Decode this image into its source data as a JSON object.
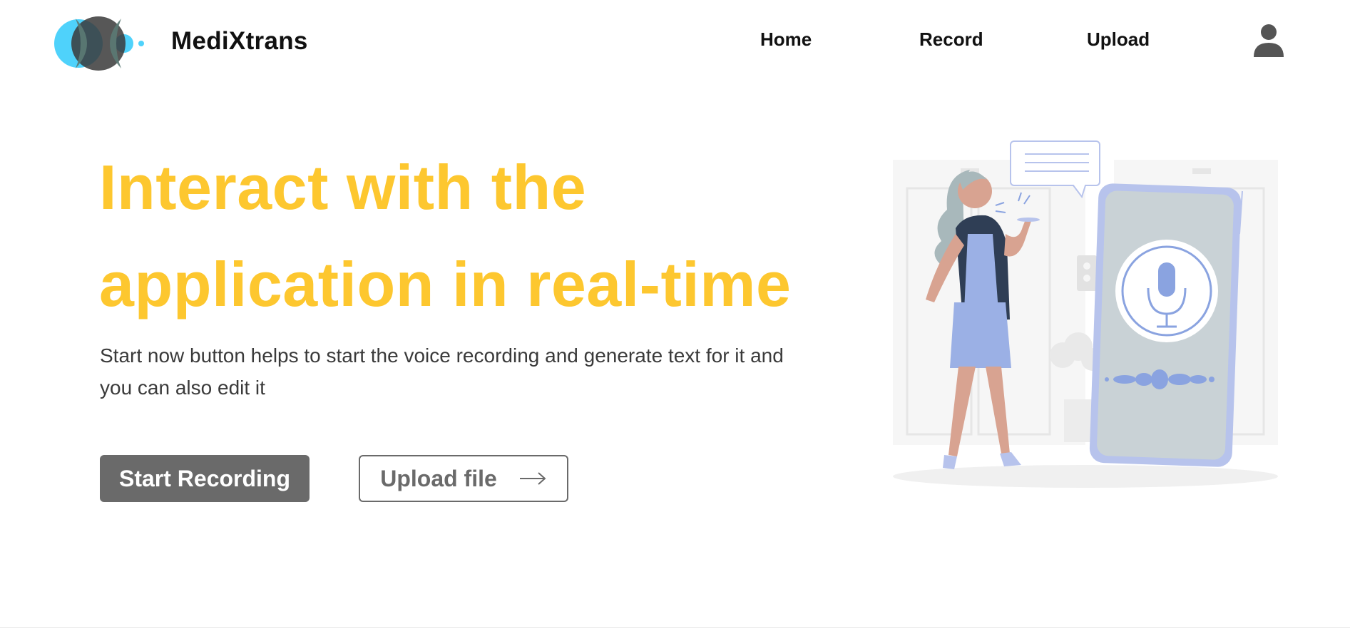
{
  "nav": {
    "brand": "MediXtrans",
    "links": {
      "home": "Home",
      "record": "Record",
      "upload": "Upload"
    },
    "logo_icon": "overlapping-circles-logo-icon",
    "user_icon": "user-avatar-icon"
  },
  "hero": {
    "headline_line1": "Interact with the",
    "headline_line2": "application in real-time",
    "subtext_line1": "Start now button helps to start the voice recording and generate text for it and",
    "subtext_line2": "you can also edit it",
    "primary_button": "Start Recording",
    "secondary_button": "Upload file",
    "secondary_icon": "right-arrow-icon",
    "illustration": "woman-talking-to-phone-microphone-illustration"
  },
  "colors": {
    "accent": "#fdc72f",
    "button_gray": "#6a6a6a",
    "logo_blue": "#4fd2fb",
    "logo_dark": "#3a3a3a",
    "illustration_blue": "#8aa3e0"
  }
}
